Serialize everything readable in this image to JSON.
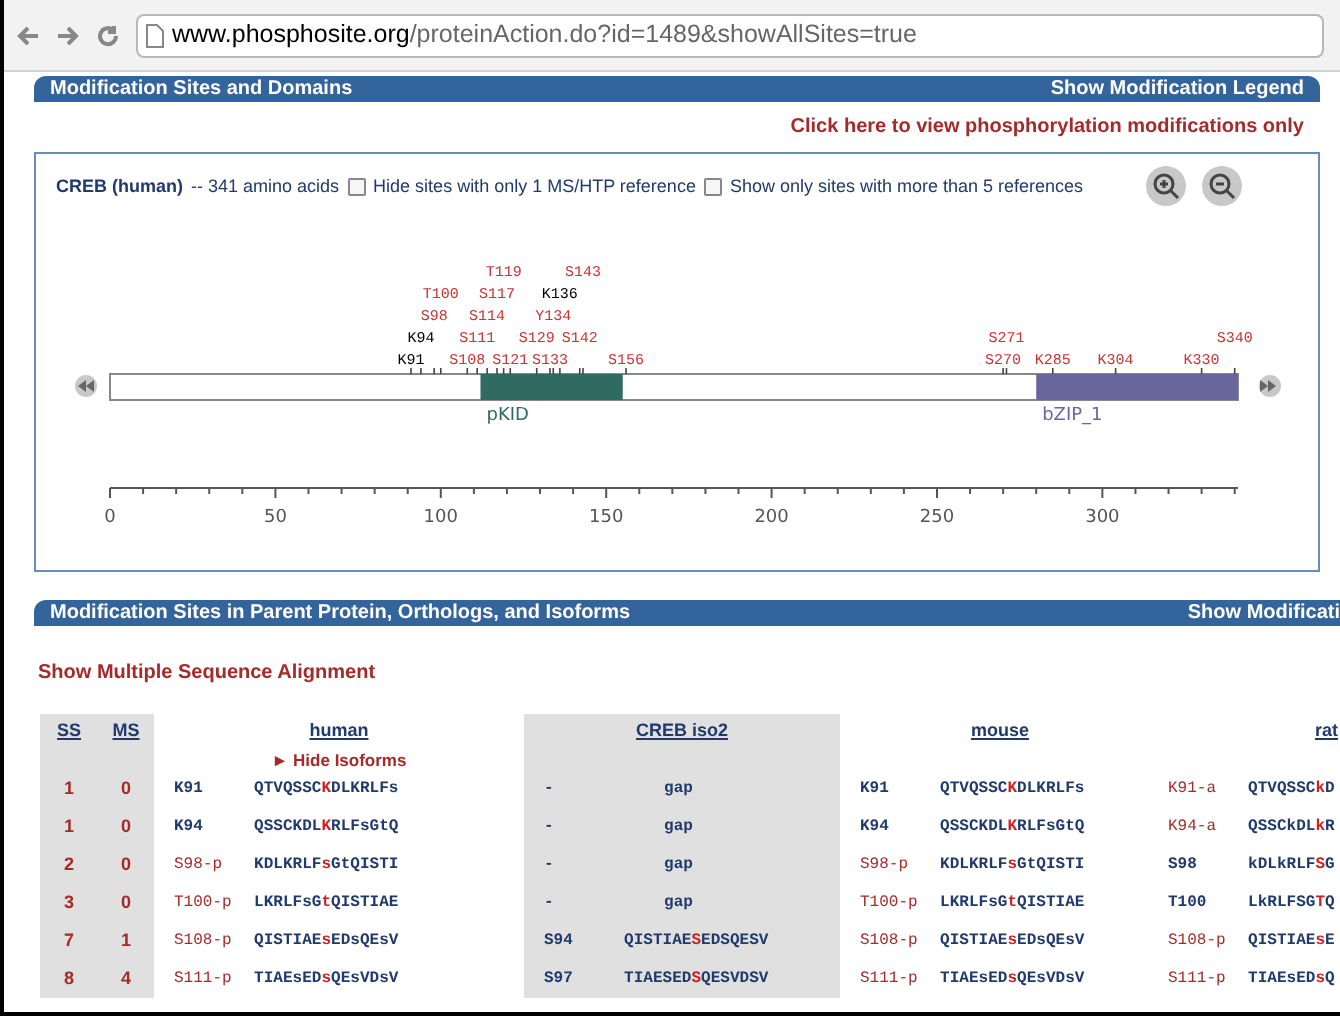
{
  "browser": {
    "url_host": "www.phosphosite.org",
    "url_path": "/proteinAction.do?id=1489&showAllSites=true"
  },
  "domains_panel": {
    "title": "Modification Sites and Domains",
    "legend_link": "Show Modification Legend",
    "phospho_link": "Click here to view phosphorylation modifications only",
    "protein": "CREB (human)",
    "length_text": "-- 341 amino acids",
    "options": [
      {
        "label": "Hide sites with only 1 MS/HTP reference",
        "checked": false
      },
      {
        "label": "Show only sites with more than 5 references",
        "checked": false
      }
    ],
    "sites": [
      {
        "label": "K91",
        "color": "#000000"
      },
      {
        "label": "S108",
        "color": "#cc3333"
      },
      {
        "label": "S121",
        "color": "#cc3333"
      },
      {
        "label": "S133",
        "color": "#cc3333"
      },
      {
        "label": "S156",
        "color": "#cc3333"
      },
      {
        "label": "S270",
        "color": "#cc3333"
      },
      {
        "label": "K285",
        "color": "#cc3333"
      },
      {
        "label": "K304",
        "color": "#cc3333"
      },
      {
        "label": "K330",
        "color": "#cc3333"
      },
      {
        "label": "K94",
        "color": "#000000"
      },
      {
        "label": "S111",
        "color": "#cc3333"
      },
      {
        "label": "S129",
        "color": "#cc3333"
      },
      {
        "label": "S142",
        "color": "#cc3333"
      },
      {
        "label": "S271",
        "color": "#cc3333"
      },
      {
        "label": "S340",
        "color": "#cc3333"
      },
      {
        "label": "S98",
        "color": "#cc3333"
      },
      {
        "label": "S114",
        "color": "#cc3333"
      },
      {
        "label": "Y134",
        "color": "#cc3333"
      },
      {
        "label": "T100",
        "color": "#cc3333"
      },
      {
        "label": "S117",
        "color": "#cc3333"
      },
      {
        "label": "K136",
        "color": "#000000"
      },
      {
        "label": "T119",
        "color": "#cc3333"
      },
      {
        "label": "S143",
        "color": "#cc3333"
      }
    ],
    "domains": [
      {
        "label": "pKID",
        "color": "#2f6b63"
      },
      {
        "label": "bZIP_1",
        "color": "#67679e"
      }
    ],
    "axis_labels": [
      "0",
      "50",
      "100",
      "150",
      "200",
      "250",
      "300"
    ]
  },
  "sites_panel": {
    "title": "Modification Sites in Parent Protein, Orthologs, and Isoforms",
    "legend_link": "Show Modificati",
    "alignment_link": "Show Multiple Sequence Alignment",
    "hide_isoforms": "► Hide Isoforms",
    "columns": [
      "SS",
      "MS",
      "human",
      "CREB iso2",
      "mouse",
      "rat"
    ],
    "rows": [
      {
        "ss": "1",
        "ms": "0",
        "human": {
          "site": "K91",
          "modified": false,
          "seq": "QTVQSSCKDLKRLFs"
        },
        "iso2": {
          "site": "-",
          "modified": false,
          "seq": "gap"
        },
        "mouse": {
          "site": "K91",
          "modified": false,
          "seq": "QTVQSSCKDLKRLFs"
        },
        "rat": {
          "site": "K91-a",
          "modified": true,
          "seq": "QTVQSSCkD"
        }
      },
      {
        "ss": "1",
        "ms": "0",
        "human": {
          "site": "K94",
          "modified": false,
          "seq": "QSSCKDLKRLFsGtQ"
        },
        "iso2": {
          "site": "-",
          "modified": false,
          "seq": "gap"
        },
        "mouse": {
          "site": "K94",
          "modified": false,
          "seq": "QSSCKDLKRLFsGtQ"
        },
        "rat": {
          "site": "K94-a",
          "modified": true,
          "seq": "QSSCkDLkR"
        }
      },
      {
        "ss": "2",
        "ms": "0",
        "human": {
          "site": "S98-p",
          "modified": true,
          "seq": "KDLKRLFsGtQISTI"
        },
        "iso2": {
          "site": "-",
          "modified": false,
          "seq": "gap"
        },
        "mouse": {
          "site": "S98-p",
          "modified": true,
          "seq": "KDLKRLFsGtQISTI"
        },
        "rat": {
          "site": "S98",
          "modified": false,
          "seq": "kDLkRLFSG"
        }
      },
      {
        "ss": "3",
        "ms": "0",
        "human": {
          "site": "T100-p",
          "modified": true,
          "seq": "LKRLFsGtQISTIAE"
        },
        "iso2": {
          "site": "-",
          "modified": false,
          "seq": "gap"
        },
        "mouse": {
          "site": "T100-p",
          "modified": true,
          "seq": "LKRLFsGtQISTIAE"
        },
        "rat": {
          "site": "T100",
          "modified": false,
          "seq": "LkRLFSGTQ"
        }
      },
      {
        "ss": "7",
        "ms": "1",
        "human": {
          "site": "S108-p",
          "modified": true,
          "seq": "QISTIAEsEDsQEsV"
        },
        "iso2": {
          "site": "S94",
          "modified": false,
          "seq": "QISTIAESEDSQESV"
        },
        "mouse": {
          "site": "S108-p",
          "modified": true,
          "seq": "QISTIAEsEDsQEsV"
        },
        "rat": {
          "site": "S108-p",
          "modified": true,
          "seq": "QISTIAEsE"
        }
      },
      {
        "ss": "8",
        "ms": "4",
        "human": {
          "site": "S111-p",
          "modified": true,
          "seq": "TIAEsEDsQEsVDsV"
        },
        "iso2": {
          "site": "S97",
          "modified": false,
          "seq": "TIAESEDSQESVDSV"
        },
        "mouse": {
          "site": "S111-p",
          "modified": true,
          "seq": "TIAEsEDsQEsVDsV"
        },
        "rat": {
          "site": "S111-p",
          "modified": true,
          "seq": "TIAEsEDsQ"
        }
      }
    ]
  }
}
